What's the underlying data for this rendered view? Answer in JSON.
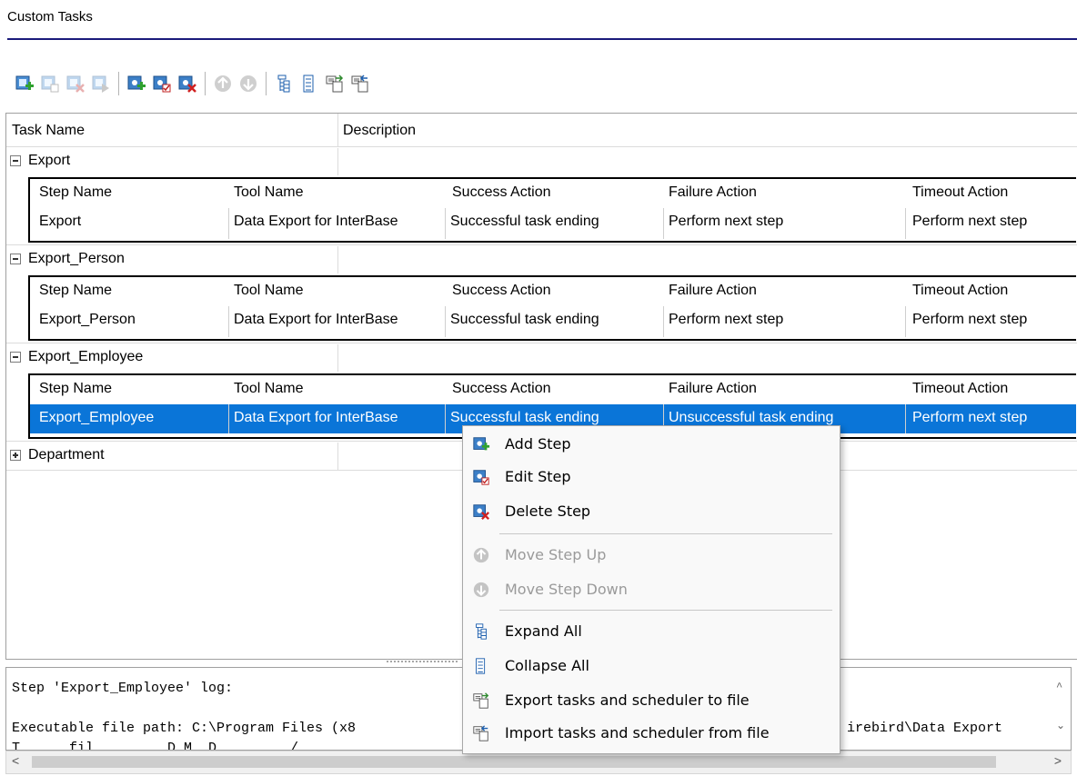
{
  "header": {
    "title": "Custom Tasks"
  },
  "toolbar": {
    "buttons": [
      {
        "name": "add-task",
        "icon": "add-task-icon",
        "enabled": true
      },
      {
        "name": "edit-task",
        "icon": "edit-task-icon",
        "enabled": false
      },
      {
        "name": "delete-task",
        "icon": "delete-task-icon",
        "enabled": false
      },
      {
        "name": "run-task",
        "icon": "run-task-icon",
        "enabled": false
      },
      {
        "name": "add-step",
        "icon": "add-step-icon",
        "enabled": true
      },
      {
        "name": "edit-step",
        "icon": "edit-step-icon",
        "enabled": true
      },
      {
        "name": "delete-step",
        "icon": "delete-step-icon",
        "enabled": true
      },
      {
        "name": "move-up",
        "icon": "move-up-icon",
        "enabled": false
      },
      {
        "name": "move-down",
        "icon": "move-down-icon",
        "enabled": false
      },
      {
        "name": "expand-all",
        "icon": "expand-all-icon",
        "enabled": true
      },
      {
        "name": "collapse-all",
        "icon": "collapse-all-icon",
        "enabled": true
      },
      {
        "name": "export-tasks",
        "icon": "export-file-icon",
        "enabled": true
      },
      {
        "name": "import-tasks",
        "icon": "import-file-icon",
        "enabled": true
      }
    ]
  },
  "grid": {
    "columns": [
      "Task Name",
      "Description"
    ],
    "detail_columns": [
      "Step Name",
      "Tool Name",
      "Success Action",
      "Failure Action",
      "Timeout Action"
    ],
    "tasks": [
      {
        "name": "Export",
        "expanded": true,
        "steps": [
          [
            "Export",
            "Data Export for InterBase",
            "Successful task ending",
            "Perform next step",
            "Perform next step"
          ]
        ]
      },
      {
        "name": "Export_Person",
        "expanded": true,
        "steps": [
          [
            "Export_Person",
            "Data Export for InterBase",
            "Successful task ending",
            "Perform next step",
            "Perform next step"
          ]
        ]
      },
      {
        "name": "Export_Employee",
        "expanded": true,
        "steps": [
          [
            "Export_Employee",
            "Data Export for InterBase",
            "Successful task ending",
            "Unsuccessful task ending",
            "Perform next step"
          ]
        ]
      },
      {
        "name": "Department",
        "expanded": false,
        "steps": []
      }
    ]
  },
  "log": {
    "line1": "Step 'Export_Employee' log:",
    "line2": "Executable file path: C:\\Program Files (x8",
    "line2_tail": "irebird\\Data Export",
    "line3": "T      fil         D M  D         /"
  },
  "context_menu": {
    "items": [
      {
        "label": "Add Step",
        "icon": "add-step-icon",
        "enabled": true
      },
      {
        "label": "Edit Step",
        "icon": "edit-step-icon",
        "enabled": true
      },
      {
        "label": "Delete Step",
        "icon": "delete-step-icon",
        "enabled": true
      },
      {
        "label": "Move Step Up",
        "icon": "move-up-icon",
        "enabled": false
      },
      {
        "label": "Move Step Down",
        "icon": "move-down-icon",
        "enabled": false
      },
      {
        "label": "Expand All",
        "icon": "expand-all-icon",
        "enabled": true
      },
      {
        "label": "Collapse All",
        "icon": "collapse-all-icon",
        "enabled": true
      },
      {
        "label": "Export tasks and scheduler to file",
        "icon": "export-file-icon",
        "enabled": true
      },
      {
        "label": "Import tasks and scheduler from file",
        "icon": "import-file-icon",
        "enabled": true
      }
    ]
  },
  "colors": {
    "selection": "#0a75d8",
    "title_rule": "#1a1a7a"
  }
}
